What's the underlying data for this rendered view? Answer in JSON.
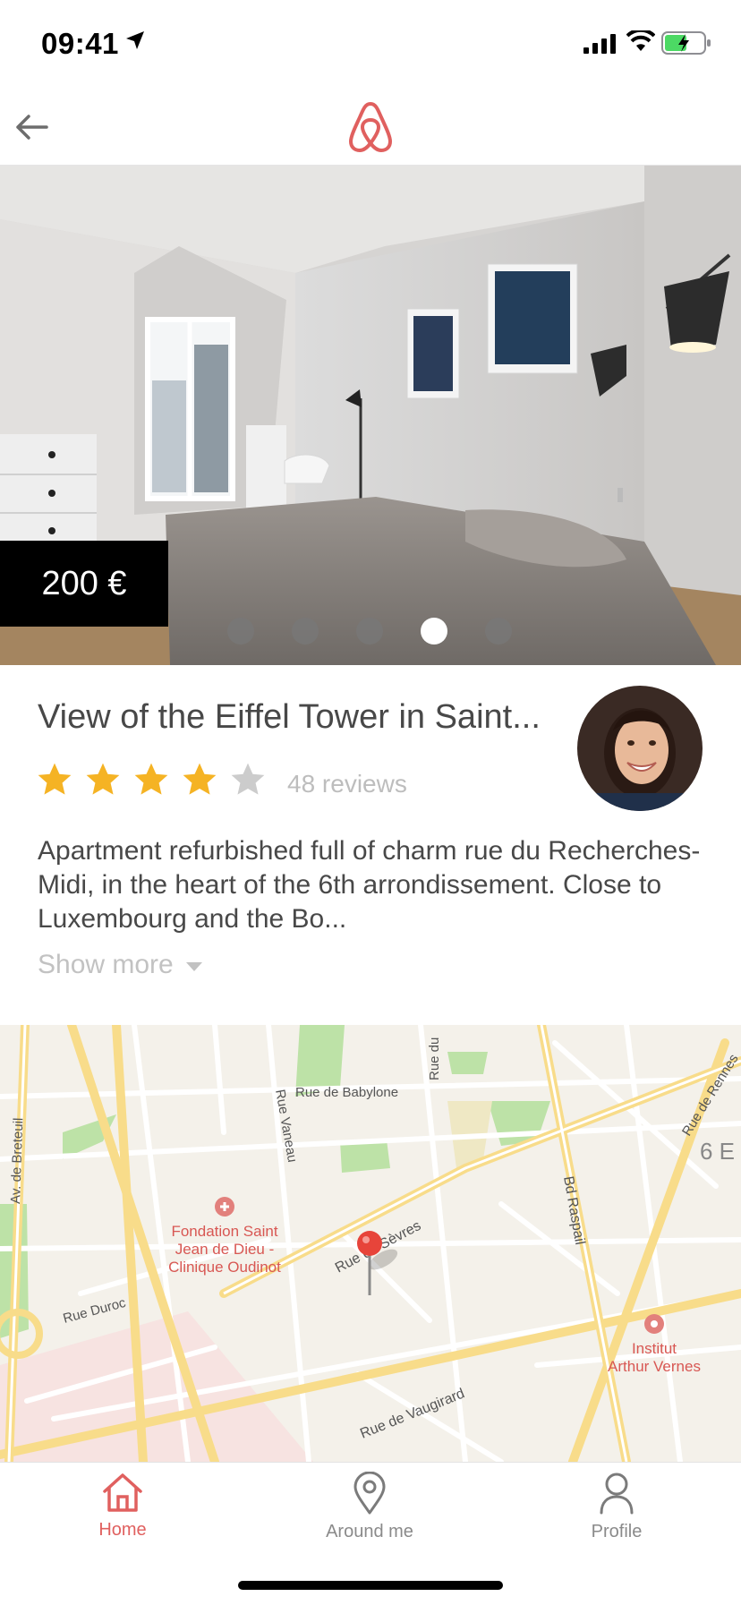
{
  "status_bar": {
    "time": "09:41"
  },
  "navbar": {
    "logo_icon": "airbnb-logo-icon",
    "back_icon": "arrow-left-icon"
  },
  "listing": {
    "price": "200 €",
    "photo_count": 5,
    "active_photo": 4,
    "title": "View of the Eiffel Tower in Saint...",
    "rating": 4,
    "rating_max": 5,
    "reviews": "48 reviews",
    "description": "Apartment refurbished full of charm rue du Recherches-Midi, in the heart of the 6th arrondissement. Close to Luxembourg and the Bo...",
    "show_more": "Show more"
  },
  "map": {
    "labels": {
      "rue_babylone": "Rue de Babylone",
      "rue_vaneau": "Rue Vaneau",
      "rue_du": "Rue du",
      "rue_rennes": "Rue de Rennes",
      "av_breteuil": "Av. de Breteuil",
      "rue_sevres": "Rue de Sèvres",
      "bd_raspail": "Bd Raspail",
      "rue_duroc": "Rue Duroc",
      "rue_vaugirard": "Rue de Vaugirard",
      "district": "6 E",
      "fondation_1": "Fondation Saint",
      "fondation_2": "Jean de Dieu -",
      "fondation_3": "Clinique Oudinot",
      "institut_1": "Institut",
      "institut_2": "Arthur Vernes"
    }
  },
  "tabs": [
    {
      "label": "Home",
      "icon": "home-icon",
      "active": true
    },
    {
      "label": "Around me",
      "icon": "map-pin-icon",
      "active": false
    },
    {
      "label": "Profile",
      "icon": "user-icon",
      "active": false
    }
  ],
  "colors": {
    "brand": "#e0605f",
    "star_filled": "#f5b324",
    "star_empty": "#cccccc",
    "text": "#484848",
    "muted": "#c2c2c2"
  }
}
